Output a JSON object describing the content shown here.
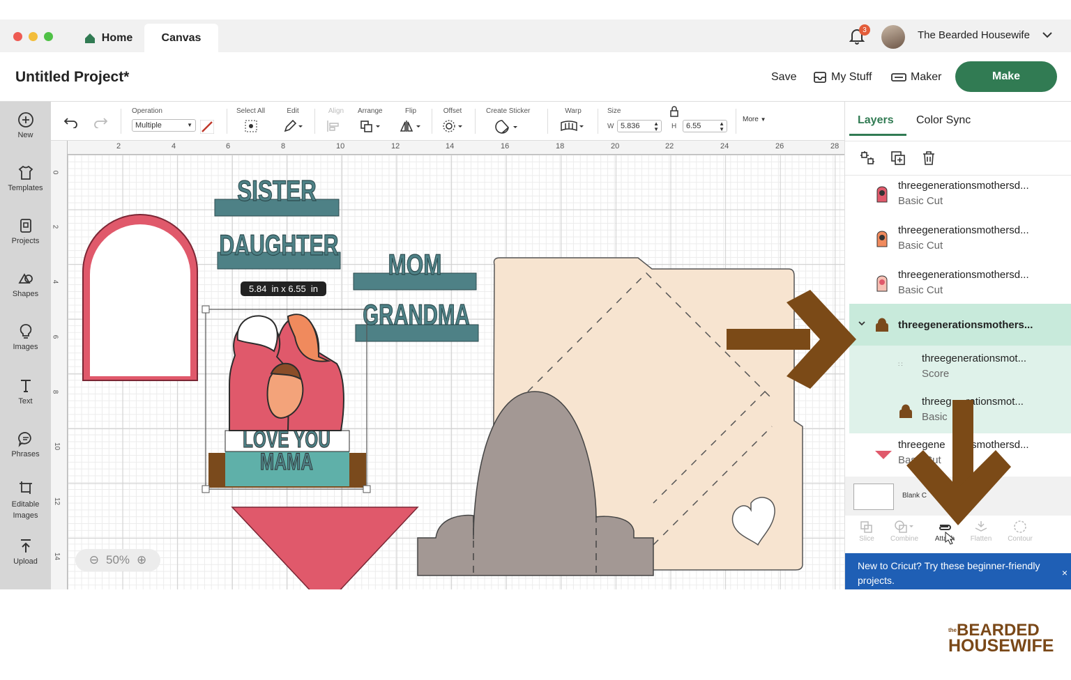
{
  "window": {
    "tabs": [
      {
        "label": "Home"
      },
      {
        "label": "Canvas"
      }
    ],
    "notification_count": "3",
    "user_name": "The Bearded Housewife"
  },
  "project": {
    "title": "Untitled Project*",
    "save_label": "Save",
    "mystuff_label": "My Stuff",
    "maker_label": "Maker",
    "make_label": "Make"
  },
  "sidebar": {
    "items": [
      {
        "label": "New",
        "icon": "plus-circle-icon"
      },
      {
        "label": "Templates",
        "icon": "shirt-icon"
      },
      {
        "label": "Projects",
        "icon": "projects-icon"
      },
      {
        "label": "Shapes",
        "icon": "shapes-icon"
      },
      {
        "label": "Images",
        "icon": "lightbulb-icon"
      },
      {
        "label": "Text",
        "icon": "text-icon"
      },
      {
        "label": "Phrases",
        "icon": "speech-bubble-icon"
      },
      {
        "label": "Editable Images",
        "icon": "editable-image-icon"
      },
      {
        "label": "Upload",
        "icon": "upload-icon"
      }
    ]
  },
  "toolbar": {
    "operation_label": "Operation",
    "operation_value": "Multiple",
    "select_all_label": "Select All",
    "edit_label": "Edit",
    "align_label": "Align",
    "arrange_label": "Arrange",
    "flip_label": "Flip",
    "offset_label": "Offset",
    "create_sticker_label": "Create Sticker",
    "warp_label": "Warp",
    "size_label": "Size",
    "w_label": "W",
    "w_value": "5.836",
    "h_label": "H",
    "h_value": "6.55",
    "more_label": "More"
  },
  "ruler": {
    "top_ticks": [
      "2",
      "4",
      "6",
      "8",
      "10",
      "12",
      "14",
      "16",
      "18",
      "20",
      "22",
      "24",
      "26",
      "28"
    ],
    "left_ticks": [
      "0",
      "2",
      "4",
      "6",
      "8",
      "10",
      "12",
      "14"
    ]
  },
  "canvas": {
    "dimension_tooltip": "5.84  in x 6.55  in",
    "texts": {
      "sister": "SISTER",
      "daughter": "DAUGHTER",
      "mom": "MOM",
      "grandma": "GRANDMA",
      "love_you": "LOVE YOU",
      "mama": "MAMA"
    },
    "zoom": "50%",
    "colors": {
      "teal": "#4e8186",
      "pink": "#e0596b",
      "tan": "#f7e4d0",
      "taupe": "#a39894",
      "brown": "#7a4a1c"
    }
  },
  "panel": {
    "tabs": [
      {
        "label": "Layers"
      },
      {
        "label": "Color Sync"
      }
    ],
    "layers": [
      {
        "name": "threegenerationsmothersd...",
        "sub": "Basic Cut"
      },
      {
        "name": "threegenerationsmothersd...",
        "sub": "Basic Cut"
      },
      {
        "name": "threegenerationsmothersd...",
        "sub": "Basic Cut"
      },
      {
        "name": "threegenerationsmothers...",
        "sub": ""
      },
      {
        "name": "threegenerationsmot...",
        "sub": "Score"
      },
      {
        "name": "threeg     rationsmot...",
        "sub": "Basic"
      },
      {
        "name": "threegene       nsmothersd...",
        "sub": "Bas   Cut"
      }
    ],
    "blank_label": "Blank C",
    "actions": [
      {
        "label": "Slice"
      },
      {
        "label": "Combine"
      },
      {
        "label": "Attach"
      },
      {
        "label": "Flatten"
      },
      {
        "label": "Contour"
      }
    ],
    "banner_text": "New to Cricut? Try these beginner-friendly projects.",
    "banner_close": "×"
  },
  "watermark": {
    "line1": "BEARDED",
    "line2": "HOUSEWIFE",
    "prefix": "the"
  }
}
